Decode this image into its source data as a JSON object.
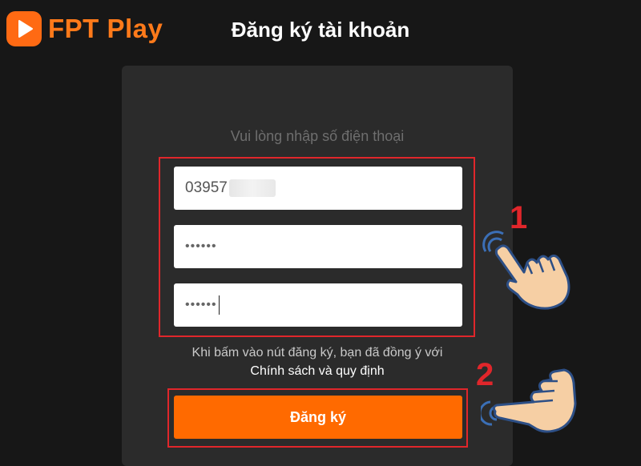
{
  "app": {
    "name": "FPT Play"
  },
  "page": {
    "title": "Đăng ký tài khoản"
  },
  "form": {
    "prompt": "Vui lòng nhập số điện thoại",
    "phone_value": "03957",
    "password_mask": "••••••",
    "confirm_mask": "••••••",
    "terms_text": "Khi bấm vào nút đăng ký, bạn đã đồng ý với",
    "policy_link": "Chính sách và quy định",
    "submit_label": "Đăng ký"
  },
  "annotations": {
    "step_1": "1",
    "step_2": "2"
  },
  "colors": {
    "brand_orange": "#ff6a00",
    "highlight_red": "#e0262b",
    "background": "#171717",
    "card": "#2b2b2b"
  },
  "icons": {
    "logo": "play-icon",
    "pointer": "pointing-hand-icon"
  }
}
